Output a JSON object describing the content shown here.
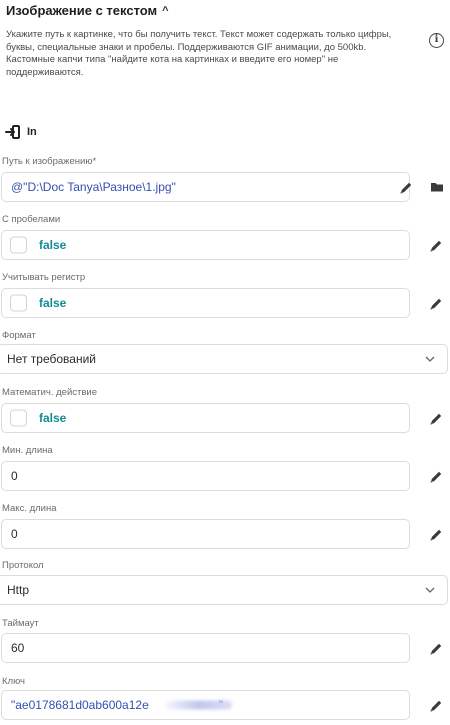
{
  "section": {
    "title": "Изображение с текстом",
    "caret": "^"
  },
  "description": "Укажите путь к картинке, что бы получить текст. Текст может содержать только цифры, буквы, специальные знаки и пробелы. Поддерживаются GIF анимации, до 500kb. Кастомные капчи типа \"найдите кота на картинках и введите его номер\" не поддерживаются.",
  "in_label": "In",
  "fields": {
    "image_path": {
      "label": "Путь к изображению*",
      "value": "@\"D:\\Doc Tanya\\Разное\\1.jpg\""
    },
    "with_spaces": {
      "label": "С пробелами",
      "value": "false"
    },
    "case_sensitive": {
      "label": "Учитывать регистр",
      "value": "false"
    },
    "format": {
      "label": "Формат",
      "value": "Нет требований"
    },
    "math_action": {
      "label": "Математич. действие",
      "value": "false"
    },
    "min_length": {
      "label": "Мин. длина",
      "value": "0"
    },
    "max_length": {
      "label": "Макс. длина",
      "value": "0"
    },
    "protocol": {
      "label": "Протокол",
      "value": "Http"
    },
    "timeout": {
      "label": "Таймаут",
      "value": "60"
    },
    "key": {
      "label": "Ключ",
      "value_start": "\"ae0178681d0ab600a12e",
      "value_end": "\""
    }
  },
  "colors": {
    "accent_teal": "#138b94",
    "path_blue": "#3450b0",
    "border": "#dcdcdc"
  },
  "icons": [
    "info-icon",
    "input-arrow-icon",
    "pencil-icon",
    "folder-icon",
    "chevron-down-icon"
  ]
}
